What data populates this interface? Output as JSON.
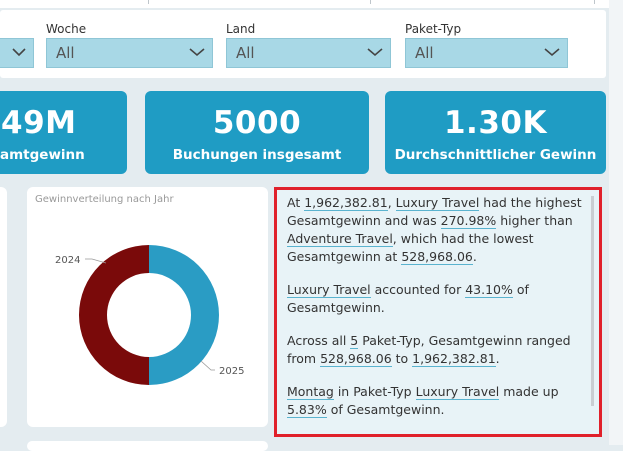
{
  "filters": [
    {
      "label": "",
      "value": ""
    },
    {
      "label": "Woche",
      "value": "All"
    },
    {
      "label": "Land",
      "value": "All"
    },
    {
      "label": "Paket-Typ",
      "value": "All"
    }
  ],
  "kpis": [
    {
      "value": "49M",
      "label": "amtgewinn"
    },
    {
      "value": "5000",
      "label": "Buchungen insgesamt"
    },
    {
      "value": "1.30K",
      "label": "Durchschnittlicher Gewinn"
    }
  ],
  "donut": {
    "title": "Gewinnverteilung nach Jahr",
    "label_2024": "2024",
    "label_2025": "2025",
    "fraction_2025": 0.5,
    "color_2024": "#7a0a0a",
    "color_2025": "#2a9cc4"
  },
  "narrative": {
    "p1": {
      "s1": "At ",
      "v1": "1,962,382.81",
      "s2": ", ",
      "v2": "Luxury Travel",
      "s3": " had the highest Gesamtgewinn and was ",
      "v3": "270.98%",
      "s4": " higher than ",
      "v4": "Adventure Travel",
      "s5": ", which had the lowest Gesamtgewinn at ",
      "v5": "528,968.06",
      "s6": "."
    },
    "p2": {
      "v1": "Luxury Travel",
      "s1": " accounted for ",
      "v2": "43.10%",
      "s2": " of Gesamtgewinn."
    },
    "p3": {
      "s1": "Across all ",
      "v1": "5",
      "s2": " Paket-Typ, Gesamtgewinn ranged from ",
      "v2": "528,968.06",
      "s3": " to ",
      "v3": "1,962,382.81",
      "s4": "."
    },
    "p4": {
      "v1": "Montag",
      "s1": " in Paket-Typ ",
      "v2": "Luxury Travel",
      "s2": " made up ",
      "v3": "5.83%",
      "s3": " of Gesamtgewinn."
    }
  }
}
